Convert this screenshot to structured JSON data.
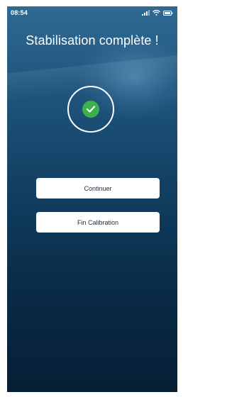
{
  "status_bar": {
    "time": "08:54",
    "icons": [
      "signal-icon",
      "wifi-icon",
      "battery-icon"
    ]
  },
  "screen": {
    "title": "Stabilisation complète !",
    "status_icon": "check-circle-icon",
    "accent_color": "#3cb049"
  },
  "actions": {
    "continue_label": "Continuer",
    "end_calibration_label": "Fin Calibration"
  }
}
